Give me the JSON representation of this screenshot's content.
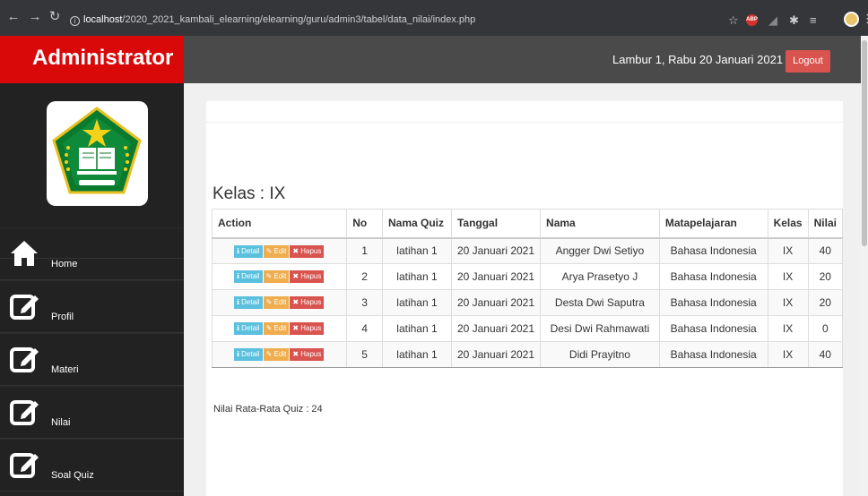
{
  "browser": {
    "url_host": "localhost",
    "url_path": "/2020_2021_kambali_elearning/elearning/guru/admin3/tabel/data_nilai/index.php"
  },
  "sidebar": {
    "brand": "Administrator",
    "items": [
      {
        "label": "Home",
        "icon": "home-icon"
      },
      {
        "label": "Profil",
        "icon": "edit-icon"
      },
      {
        "label": "Materi",
        "icon": "edit-icon"
      },
      {
        "label": "Nilai",
        "icon": "edit-icon"
      },
      {
        "label": "Soal Quiz",
        "icon": "edit-icon"
      }
    ]
  },
  "header": {
    "date_text": "Lambur 1, Rabu 20 Januari 2021",
    "logout_label": "Logout"
  },
  "main": {
    "kelas_label": "Kelas : IX",
    "columns": [
      "Action",
      "No",
      "Nama Quiz",
      "Tanggal",
      "Nama",
      "Matapelajaran",
      "Kelas",
      "Nilai"
    ],
    "actions": {
      "detail": "Detail",
      "edit": "Edit",
      "hapus": "Hapus"
    },
    "rows": [
      {
        "no": "1",
        "quiz": "latihan 1",
        "tanggal": "20 Januari 2021",
        "nama": "Angger Dwi Setiyo",
        "mapel": "Bahasa Indonesia",
        "kelas": "IX",
        "nilai": "40"
      },
      {
        "no": "2",
        "quiz": "latihan 1",
        "tanggal": "20 Januari 2021",
        "nama": "Arya Prasetyo J",
        "mapel": "Bahasa Indonesia",
        "kelas": "IX",
        "nilai": "20"
      },
      {
        "no": "3",
        "quiz": "latihan 1",
        "tanggal": "20 Januari 2021",
        "nama": "Desta Dwi Saputra",
        "mapel": "Bahasa Indonesia",
        "kelas": "IX",
        "nilai": "20"
      },
      {
        "no": "4",
        "quiz": "latihan 1",
        "tanggal": "20 Januari 2021",
        "nama": "Desi Dwi Rahmawati",
        "mapel": "Bahasa Indonesia",
        "kelas": "IX",
        "nilai": "0"
      },
      {
        "no": "5",
        "quiz": "latihan 1",
        "tanggal": "20 Januari 2021",
        "nama": "Didi Prayitno",
        "mapel": "Bahasa Indonesia",
        "kelas": "IX",
        "nilai": "40"
      }
    ],
    "average_text": "Nilai Rata-Rata Quiz : 24"
  },
  "colors": {
    "brand_red": "#d9090a",
    "sidebar_bg": "#222222",
    "header_bg": "#4a4a4a",
    "detail": "#5bc0de",
    "edit": "#f0ad4e",
    "hapus": "#d9534f"
  }
}
